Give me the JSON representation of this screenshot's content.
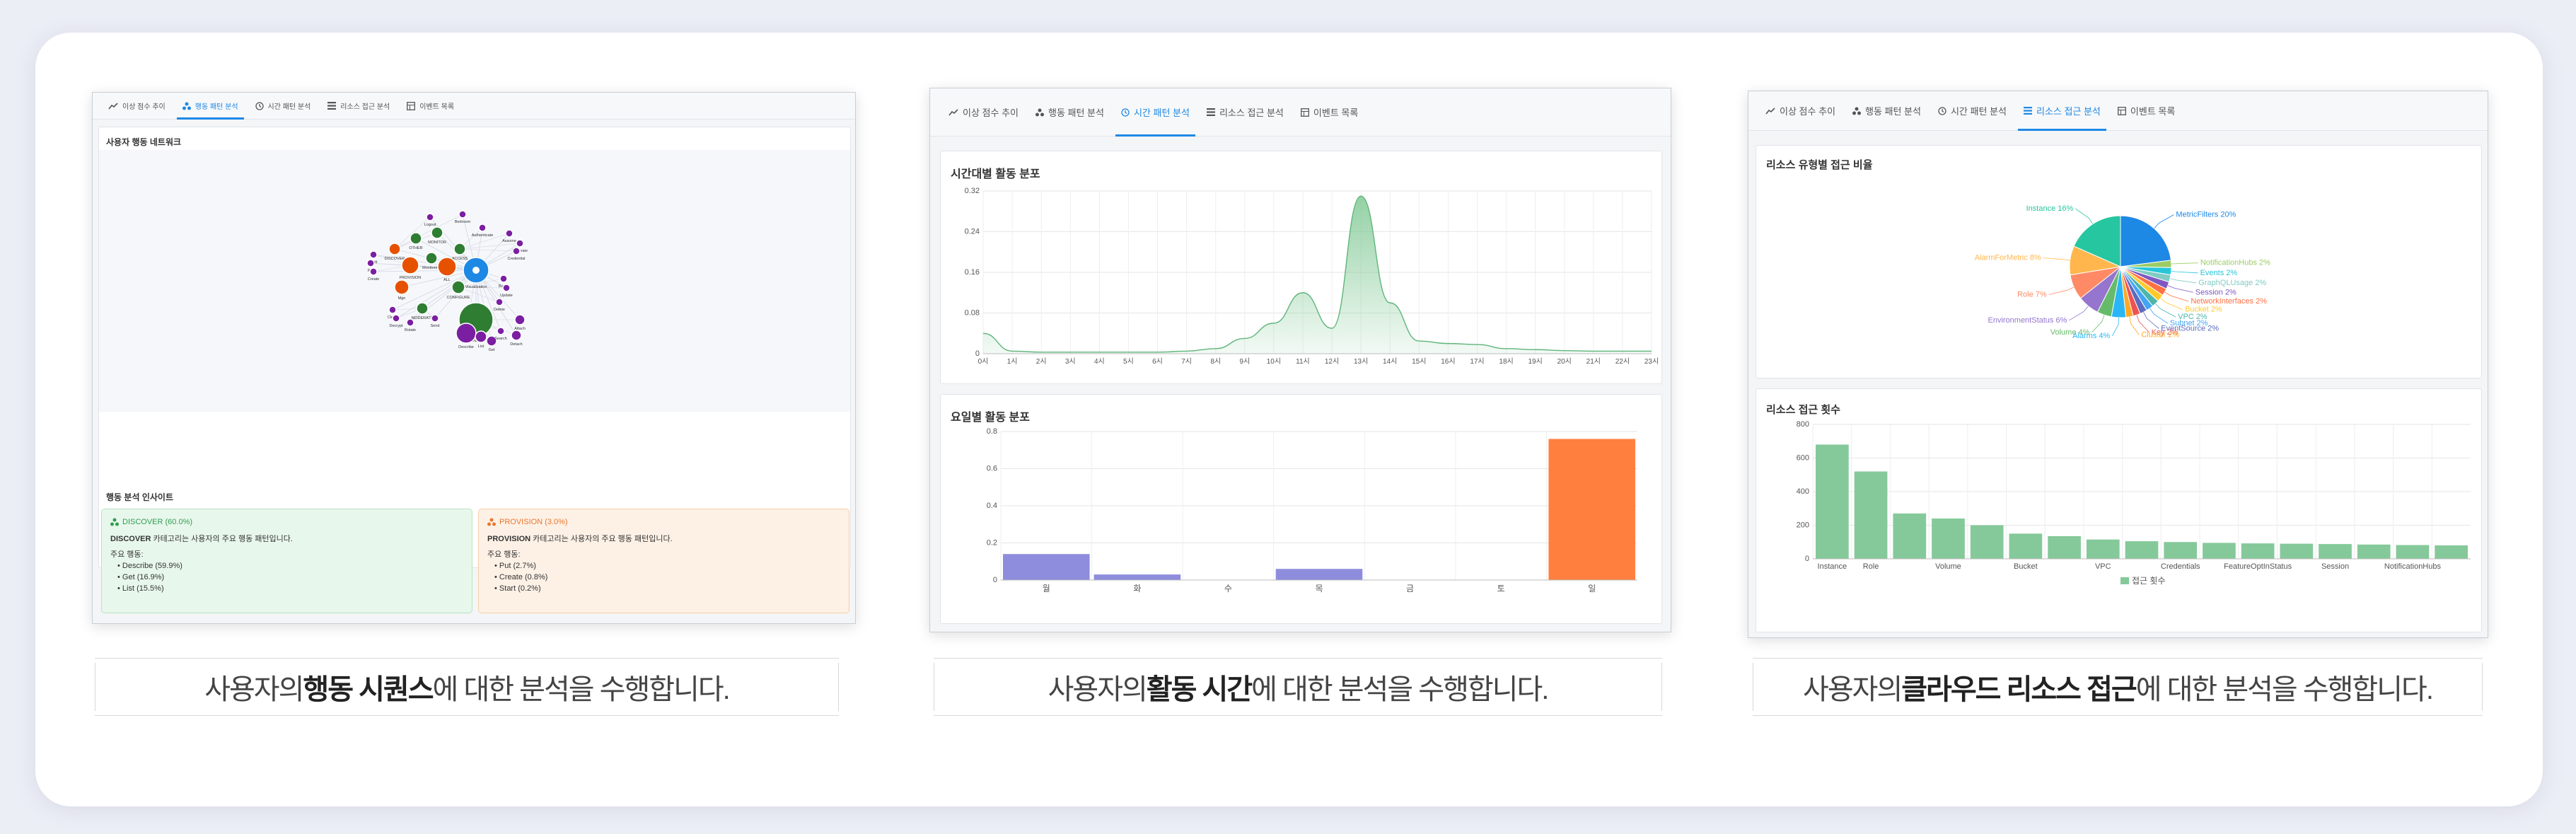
{
  "tabs": [
    {
      "label": "이상 점수 추이",
      "icon": "trend-icon"
    },
    {
      "label": "행동 패턴 분석",
      "icon": "network-icon"
    },
    {
      "label": "시간 패턴 분석",
      "icon": "clock-icon"
    },
    {
      "label": "리소스 접근 분석",
      "icon": "list-icon"
    },
    {
      "label": "이벤트 목록",
      "icon": "table-icon"
    }
  ],
  "panel1": {
    "active_tab": 1,
    "network_title": "사용자 행동 네트워크",
    "nodes": [
      {
        "label": "Logout",
        "c": "#7b1fa2",
        "r": 5
      },
      {
        "label": "Bedroom",
        "c": "#7b1fa2",
        "r": 5
      },
      {
        "label": "OTHER",
        "c": "#2e7d32",
        "r": 8
      },
      {
        "label": "MONITOR",
        "c": "#2e7d32",
        "r": 8
      },
      {
        "label": "Authenticate",
        "c": "#7b1fa2",
        "r": 5
      },
      {
        "label": "Assume",
        "c": "#7b1fa2",
        "r": 5
      },
      {
        "label": "Federate",
        "c": "#7b1fa2",
        "r": 5
      },
      {
        "label": "Credential",
        "c": "#7b1fa2",
        "r": 5
      },
      {
        "label": "DISCOVER",
        "c": "#e65100",
        "r": 8
      },
      {
        "label": "ACCESS",
        "c": "#2e7d32",
        "r": 8
      },
      {
        "label": "Monitoring",
        "c": "#2e7d32",
        "r": 8
      },
      {
        "label": "Mult",
        "c": "#7b1fa2",
        "r": 5
      },
      {
        "label": "Put",
        "c": "#7b1fa2",
        "r": 5
      },
      {
        "label": "Create",
        "c": "#7b1fa2",
        "r": 5
      },
      {
        "label": "PROVISION",
        "c": "#e65100",
        "r": 12
      },
      {
        "label": "ALL",
        "c": "#e65100",
        "r": 13
      },
      {
        "label": "Visualization",
        "c": "#1e88e5",
        "r": 18
      },
      {
        "label": "CONFIGURE",
        "c": "#2e7d32",
        "r": 9
      },
      {
        "label": "Batch",
        "c": "#7b1fa2",
        "r": 5
      },
      {
        "label": "Update",
        "c": "#7b1fa2",
        "r": 5
      },
      {
        "label": "Mgn",
        "c": "#e65100",
        "r": 10
      },
      {
        "label": "Delete",
        "c": "#7b1fa2",
        "r": 5
      },
      {
        "label": "MODERATE",
        "c": "#2e7d32",
        "r": 8
      },
      {
        "label": "Clean",
        "c": "#7b1fa2",
        "r": 5
      },
      {
        "label": "Decrypt",
        "c": "#7b1fa2",
        "r": 5
      },
      {
        "label": "Rotate",
        "c": "#7b1fa2",
        "r": 5
      },
      {
        "label": "Send",
        "c": "#7b1fa2",
        "r": 5
      },
      {
        "label": "MANAGE",
        "c": "#2e7d32",
        "r": 24
      },
      {
        "label": "Attach",
        "c": "#7b1fa2",
        "r": 7
      },
      {
        "label": "Detach",
        "c": "#7b1fa2",
        "r": 7
      },
      {
        "label": "Describe",
        "c": "#7b1fa2",
        "r": 14
      },
      {
        "label": "List",
        "c": "#7b1fa2",
        "r": 8
      },
      {
        "label": "Get",
        "c": "#7b1fa2",
        "r": 7
      },
      {
        "label": "Search",
        "c": "#7b1fa2",
        "r": 5
      }
    ],
    "insights_title": "행동 분석 인사이트",
    "insight_a": {
      "title": "DISCOVER (60.0%)",
      "name": "DISCOVER",
      "desc": " 카테고리는 사용자의 주요 행동 패턴입니다.",
      "main_label": "주요 행동:",
      "items": [
        "Describe (59.9%)",
        "Get (16.9%)",
        "List (15.5%)"
      ]
    },
    "insight_b": {
      "title": "PROVISION (3.0%)",
      "name": "PROVISION",
      "desc": " 카테고리는 사용자의 주요 행동 패턴입니다.",
      "main_label": "주요 행동:",
      "items": [
        "Put (2.7%)",
        "Create (0.8%)",
        "Start (0.2%)"
      ]
    }
  },
  "panel2": {
    "active_tab": 2,
    "hourly_title": "시간대별 활동 분포",
    "weekly_title": "요일별 활동 분포"
  },
  "panel3": {
    "active_tab": 3,
    "pie_title": "리소스 유형별 접근 비율",
    "bar_title": "리소스 접근 횟수",
    "legend_label": "접근 횟수"
  },
  "captions": [
    {
      "pre": "사용자의 ",
      "bold": "행동 시퀀스",
      "post": "에 대한 분석을 수행합니다."
    },
    {
      "pre": "사용자의 ",
      "bold": "활동 시간",
      "post": "에 대한 분석을 수행합니다."
    },
    {
      "pre": "사용자의 ",
      "bold": "클라우드 리소스 접근",
      "post": "에 대한 분석을 수행합니다."
    }
  ],
  "chart_data": [
    {
      "type": "area",
      "title": "시간대별 활동 분포",
      "x": [
        "0시",
        "1시",
        "2시",
        "3시",
        "4시",
        "5시",
        "6시",
        "7시",
        "8시",
        "9시",
        "10시",
        "11시",
        "12시",
        "13시",
        "14시",
        "15시",
        "16시",
        "17시",
        "18시",
        "19시",
        "20시",
        "21시",
        "22시",
        "23시"
      ],
      "values": [
        0.04,
        0.005,
        0.003,
        0.003,
        0.003,
        0.003,
        0.003,
        0.005,
        0.01,
        0.03,
        0.06,
        0.12,
        0.05,
        0.31,
        0.1,
        0.025,
        0.02,
        0.018,
        0.01,
        0.008,
        0.006,
        0.005,
        0.005,
        0.005
      ],
      "ylim": [
        0,
        0.32
      ],
      "yticks": [
        0,
        0.08,
        0.16,
        0.24,
        0.32
      ],
      "grid": true,
      "color": "#81c995"
    },
    {
      "type": "bar",
      "title": "요일별 활동 분포",
      "categories": [
        "월",
        "화",
        "수",
        "목",
        "금",
        "토",
        "일"
      ],
      "values": [
        0.14,
        0.03,
        0.0,
        0.06,
        0.0,
        0.0,
        0.76
      ],
      "colors": [
        "#8e8cdc",
        "#8e8cdc",
        "#8e8cdc",
        "#8e8cdc",
        "#8e8cdc",
        "#8e8cdc",
        "#ff7f3f"
      ],
      "ylim": [
        0,
        0.8
      ],
      "yticks": [
        0,
        0.2,
        0.4,
        0.6,
        0.8
      ],
      "grid": true
    },
    {
      "type": "pie",
      "title": "리소스 유형별 접근 비율",
      "slices": [
        {
          "label": "MetricFilters 20%",
          "value": 20,
          "color": "#1e88e5"
        },
        {
          "label": "NotificationHubs 2%",
          "value": 2,
          "color": "#9ccc65"
        },
        {
          "label": "Events 2%",
          "value": 2,
          "color": "#26c6da"
        },
        {
          "label": "GraphQLUsage 2%",
          "value": 2,
          "color": "#80cbc4"
        },
        {
          "label": "Session 2%",
          "value": 2,
          "color": "#7e57c2"
        },
        {
          "label": "NetworkInterfaces 2%",
          "value": 2,
          "color": "#ff7043"
        },
        {
          "label": "Bucket 2%",
          "value": 2,
          "color": "#ffca28"
        },
        {
          "label": "VPC 2%",
          "value": 2,
          "color": "#4db6ac"
        },
        {
          "label": "Subnet 2%",
          "value": 2,
          "color": "#42a5f5"
        },
        {
          "label": "EventSource 2%",
          "value": 2,
          "color": "#5c6bc0"
        },
        {
          "label": "Key 2%",
          "value": 2,
          "color": "#ef5350"
        },
        {
          "label": "Cluster 2%",
          "value": 2,
          "color": "#ffa726"
        },
        {
          "label": "Alarms 4%",
          "value": 4,
          "color": "#29b6f6"
        },
        {
          "label": "Volume 4%",
          "value": 4,
          "color": "#66bb6a"
        },
        {
          "label": "EnvironmentStatus 6%",
          "value": 6,
          "color": "#9575cd"
        },
        {
          "label": "Role 7%",
          "value": 7,
          "color": "#ff8a65"
        },
        {
          "label": "AlarmForMetric 8%",
          "value": 8,
          "color": "#ffb74d"
        },
        {
          "label": "Instance 16%",
          "value": 16,
          "color": "#26c6a0"
        }
      ]
    },
    {
      "type": "bar",
      "title": "리소스 접근 횟수",
      "categories": [
        "Instance",
        "Role",
        "",
        "Volume",
        "",
        "Bucket",
        "",
        "VPC",
        "",
        "Credentials",
        "",
        "FeatureOptInStatus",
        "",
        "Session",
        "",
        "NotificationHubs",
        ""
      ],
      "values": [
        680,
        520,
        270,
        240,
        200,
        150,
        135,
        115,
        105,
        100,
        95,
        92,
        90,
        88,
        85,
        82,
        80
      ],
      "ylim": [
        0,
        800
      ],
      "yticks": [
        0,
        200,
        400,
        600,
        800
      ],
      "series": [
        {
          "name": "접근 횟수",
          "values": [
            680,
            520,
            270,
            240,
            200,
            150,
            135,
            115,
            105,
            100,
            95,
            92,
            90,
            88,
            85,
            82,
            80
          ]
        }
      ],
      "color": "#85c99a",
      "grid": true,
      "legend": "bottom"
    }
  ]
}
